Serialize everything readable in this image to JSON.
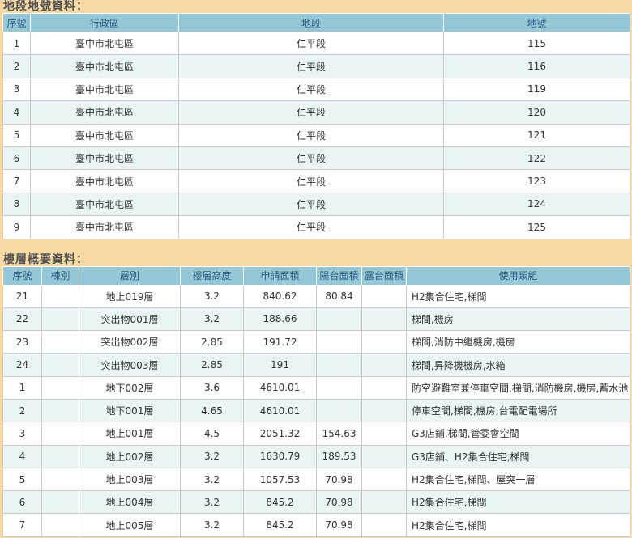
{
  "land": {
    "title": "地段地號資料：",
    "headers": [
      "序號",
      "行政區",
      "地段",
      "地號"
    ],
    "rows": [
      [
        "1",
        "臺中市北屯區",
        "仁平段",
        "115"
      ],
      [
        "2",
        "臺中市北屯區",
        "仁平段",
        "116"
      ],
      [
        "3",
        "臺中市北屯區",
        "仁平段",
        "119"
      ],
      [
        "4",
        "臺中市北屯區",
        "仁平段",
        "120"
      ],
      [
        "5",
        "臺中市北屯區",
        "仁平段",
        "121"
      ],
      [
        "6",
        "臺中市北屯區",
        "仁平段",
        "122"
      ],
      [
        "7",
        "臺中市北屯區",
        "仁平段",
        "123"
      ],
      [
        "8",
        "臺中市北屯區",
        "仁平段",
        "124"
      ],
      [
        "9",
        "臺中市北屯區",
        "仁平段",
        "125"
      ]
    ]
  },
  "floor": {
    "title": "樓層概要資料：",
    "headers": [
      "序號",
      "棟別",
      "層別",
      "樓層高度",
      "申請面積",
      "陽台面積",
      "露台面積",
      "使用類組"
    ],
    "rows": [
      [
        "21",
        "",
        "地上019層",
        "3.2",
        "840.62",
        "80.84",
        "",
        "H2集合住宅,梯間"
      ],
      [
        "22",
        "",
        "突出物001層",
        "3.2",
        "188.66",
        "",
        "",
        "梯間,機房"
      ],
      [
        "23",
        "",
        "突出物002層",
        "2.85",
        "191.72",
        "",
        "",
        "梯間,消防中繼機房,機房"
      ],
      [
        "24",
        "",
        "突出物003層",
        "2.85",
        "191",
        "",
        "",
        "梯間,昇降機機房,水箱"
      ],
      [
        "1",
        "",
        "地下002層",
        "3.6",
        "4610.01",
        "",
        "",
        "防空避難室兼停車空間,梯間,消防機房,機房,蓄水池"
      ],
      [
        "2",
        "",
        "地下001層",
        "4.65",
        "4610.01",
        "",
        "",
        "停車空間,梯間,機房,台電配電場所"
      ],
      [
        "3",
        "",
        "地上001層",
        "4.5",
        "2051.32",
        "154.63",
        "",
        "G3店鋪,梯間,管委會空間"
      ],
      [
        "4",
        "",
        "地上002層",
        "3.2",
        "1630.79",
        "189.53",
        "",
        "G3店鋪、H2集合住宅,梯間"
      ],
      [
        "5",
        "",
        "地上003層",
        "3.2",
        "1057.53",
        "70.98",
        "",
        "H2集合住宅,梯間、屋突一層"
      ],
      [
        "6",
        "",
        "地上004層",
        "3.2",
        "845.2",
        "70.98",
        "",
        "H2集合住宅,梯間"
      ],
      [
        "7",
        "",
        "地上005層",
        "3.2",
        "845.2",
        "70.98",
        "",
        "H2集合住宅,梯間"
      ]
    ]
  }
}
